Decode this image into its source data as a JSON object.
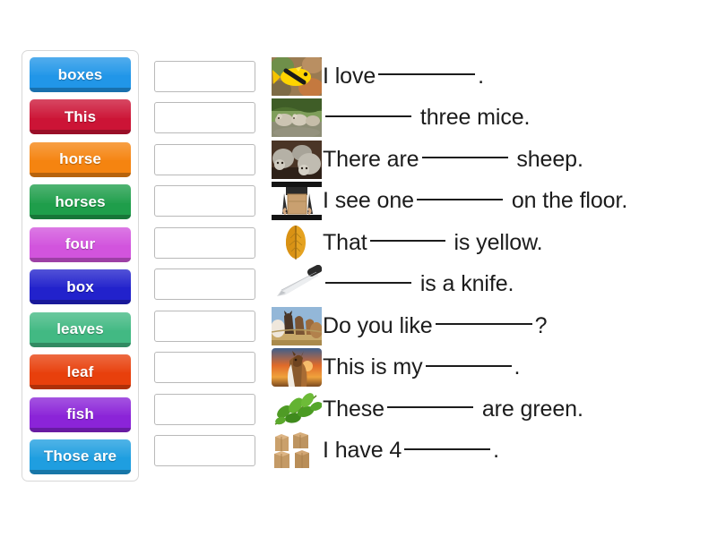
{
  "activity": {
    "type": "drag-and-drop-fill-in-the-blank",
    "word_bank": {
      "name": "word-bank",
      "tiles": [
        {
          "label": "boxes",
          "color": "#2196e8"
        },
        {
          "label": "This",
          "color": "#cc1436"
        },
        {
          "label": "horse",
          "color": "#f58410"
        },
        {
          "label": "horses",
          "color": "#1f9e4b"
        },
        {
          "label": "four",
          "color": "#d254dd"
        },
        {
          "label": "box",
          "color": "#2222cc"
        },
        {
          "label": "leaves",
          "color": "#42b983"
        },
        {
          "label": "leaf",
          "color": "#e8400c"
        },
        {
          "label": "fish",
          "color": "#8b24d8"
        },
        {
          "label": "Those are",
          "color": "#1f9ee0"
        }
      ]
    },
    "rows": [
      {
        "image": "yellow-fish-photo",
        "before": "I love",
        "blank": "lg",
        "after": "."
      },
      {
        "image": "three-mice-photo",
        "before": "",
        "blank": "md",
        "after": " three mice."
      },
      {
        "image": "sheep-flock-photo",
        "before": "There are",
        "blank": "md",
        "after": " sheep."
      },
      {
        "image": "person-holding-box-photo",
        "before": "I see one",
        "blank": "md",
        "after": " on the floor."
      },
      {
        "image": "yellow-leaf-photo",
        "before": "That",
        "blank": "sm",
        "after": " is yellow."
      },
      {
        "image": "kitchen-knife-photo",
        "before": "",
        "blank": "md",
        "after": " is a knife."
      },
      {
        "image": "horse-herd-photo",
        "before": "Do you like",
        "blank": "lg",
        "after": "?"
      },
      {
        "image": "horse-sunset-photo",
        "before": "This is my",
        "blank": "md",
        "after": "."
      },
      {
        "image": "green-leaves-photo",
        "before": "These",
        "blank": "md",
        "after": " are green."
      },
      {
        "image": "cardboard-boxes-photo",
        "before": "I have 4",
        "blank": "md",
        "after": "."
      }
    ]
  }
}
